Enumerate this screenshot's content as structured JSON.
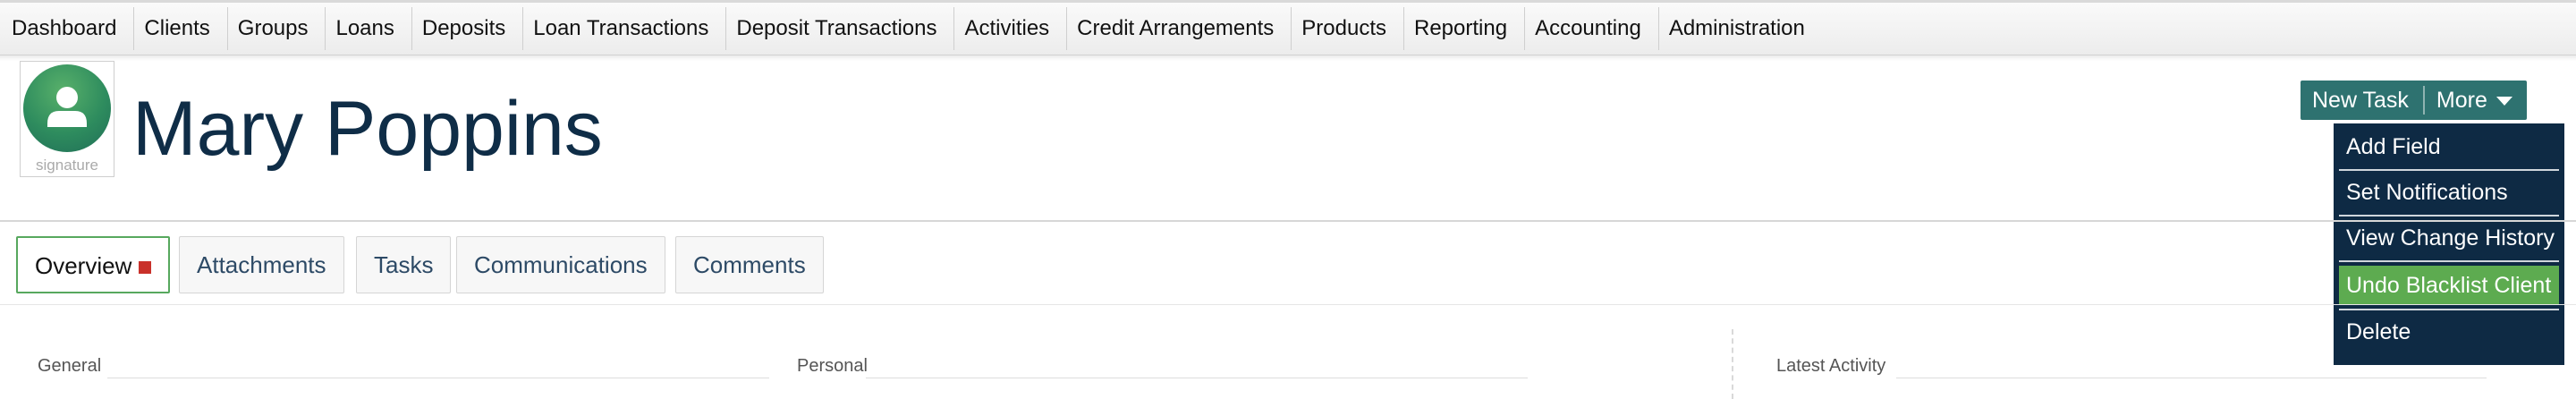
{
  "nav": {
    "items": [
      "Dashboard",
      "Clients",
      "Groups",
      "Loans",
      "Deposits",
      "Loan Transactions",
      "Deposit Transactions",
      "Activities",
      "Credit Arrangements",
      "Products",
      "Reporting",
      "Accounting",
      "Administration"
    ]
  },
  "client": {
    "name": "Mary Poppins",
    "avatar_caption": "signature",
    "avatar_icon": "user-icon"
  },
  "actions": {
    "new_task_label": "New Task",
    "more_label": "More",
    "more_icon": "caret-down-icon",
    "menu": [
      "Add Field",
      "Set Notifications",
      "View Change History",
      "Undo Blacklist Client",
      "Delete"
    ],
    "highlighted_index": 3
  },
  "tabs": [
    "Overview",
    "Attachments",
    "Tasks",
    "Communications",
    "Comments"
  ],
  "sections": {
    "general": "General",
    "personal": "Personal",
    "latest_activity": "Latest Activity"
  },
  "colors": {
    "brand_dark": "#0f2d47",
    "button_teal": "#2e7270",
    "menu_bg": "#0e2a44",
    "menu_highlight": "#5dab50",
    "active_tab_border": "#57a85e",
    "changed_marker": "#c9312a"
  }
}
